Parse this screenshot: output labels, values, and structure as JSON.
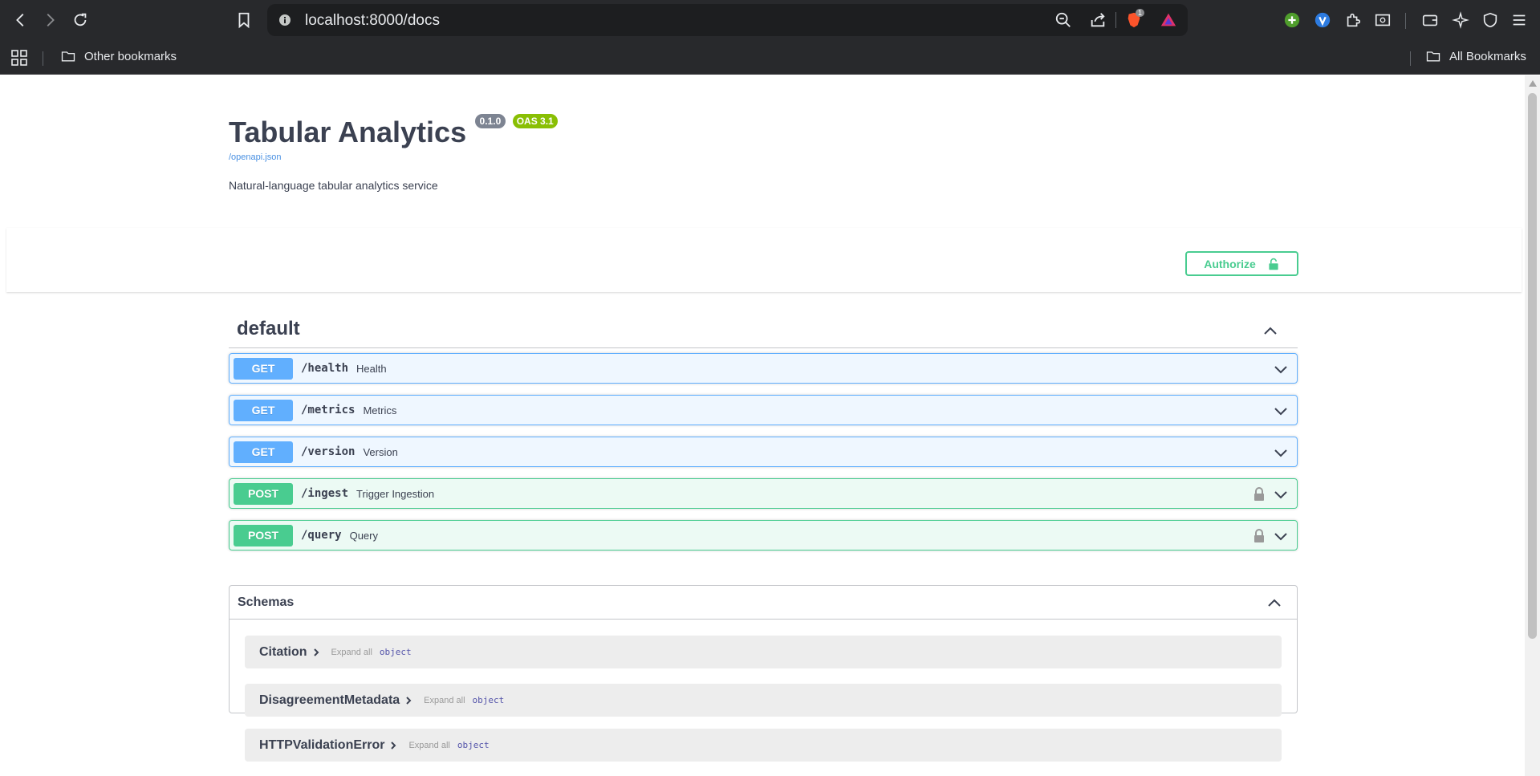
{
  "browser": {
    "url": "localhost:8000/docs",
    "bookmarks": {
      "other": "Other bookmarks",
      "all": "All Bookmarks"
    },
    "brave_badge": "1"
  },
  "api": {
    "title": "Tabular Analytics",
    "version": "0.1.0",
    "oas": "OAS 3.1",
    "openapi_link": "/openapi.json",
    "description": "Natural-language tabular analytics service",
    "authorize_label": "Authorize"
  },
  "tag": {
    "name": "default"
  },
  "operations": [
    {
      "method": "GET",
      "path": "/health",
      "summary": "Health",
      "locked": false
    },
    {
      "method": "GET",
      "path": "/metrics",
      "summary": "Metrics",
      "locked": false
    },
    {
      "method": "GET",
      "path": "/version",
      "summary": "Version",
      "locked": false
    },
    {
      "method": "POST",
      "path": "/ingest",
      "summary": "Trigger Ingestion",
      "locked": true
    },
    {
      "method": "POST",
      "path": "/query",
      "summary": "Query",
      "locked": true
    }
  ],
  "schemas": {
    "title": "Schemas",
    "expand_all": "Expand all",
    "items": [
      {
        "name": "Citation",
        "type": "object"
      },
      {
        "name": "DisagreementMetadata",
        "type": "object"
      },
      {
        "name": "HTTPValidationError",
        "type": "object"
      }
    ]
  },
  "colors": {
    "get": "#61affe",
    "post": "#49cc90",
    "oas": "#89bf04",
    "version": "#7d8492"
  }
}
